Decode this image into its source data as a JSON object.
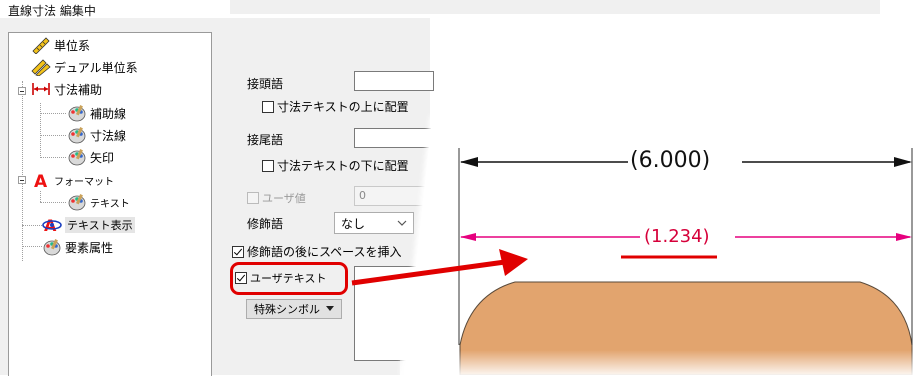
{
  "window": {
    "title": "直線寸法 編集中"
  },
  "tree": {
    "items": [
      {
        "label": "単位系",
        "icon": "ruler-icon"
      },
      {
        "label": "デュアル単位系",
        "icon": "dual-ruler-icon"
      },
      {
        "label": "寸法補助",
        "icon": "dimension-arrow-icon"
      },
      {
        "label": "補助線",
        "icon": "palette-icon"
      },
      {
        "label": "寸法線",
        "icon": "palette-icon"
      },
      {
        "label": "矢印",
        "icon": "palette-icon"
      },
      {
        "label": "フォーマット",
        "icon": "format-a-icon"
      },
      {
        "label": "テキスト",
        "icon": "palette-icon"
      },
      {
        "label": "テキスト表示",
        "icon": "text-display-icon",
        "selected": true
      },
      {
        "label": "要素属性",
        "icon": "palette-icon"
      }
    ]
  },
  "form": {
    "prefix_label": "接頭語",
    "prefix_value": "",
    "above_checkbox_label": "寸法テキストの上に配置",
    "suffix_label": "接尾語",
    "suffix_value": "",
    "below_checkbox_label": "寸法テキストの下に配置",
    "user_value_label": "ユーザ値",
    "user_value": "0",
    "modifier_label": "修飾語",
    "modifier_value": "なし",
    "space_checkbox_label": "修飾語の後にスペースを挿入",
    "user_text_label": "ユーザテキスト",
    "special_symbol_button": "特殊シンボル"
  },
  "preview": {
    "dim_top": "(6.000)",
    "dim_bottom": "(1.234)"
  },
  "colors": {
    "highlight": "#e00000",
    "arrow": "#e00000",
    "magenta": "#e6007e",
    "shape_fill": "#e2a46e",
    "dim_bottom_text": "#d6003a"
  }
}
